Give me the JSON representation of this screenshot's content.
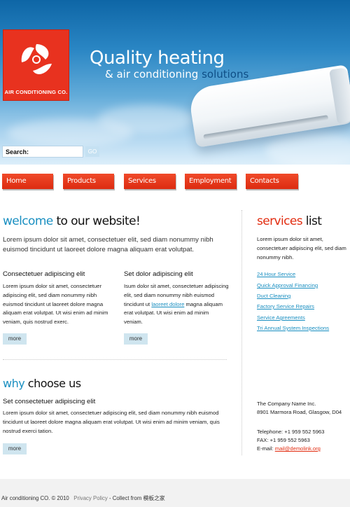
{
  "header": {
    "logo_text": "AIR CONDITIONING CO.",
    "tagline_main": "Quality heating",
    "tagline_sub_a": "& air conditioning ",
    "tagline_sub_b": "solutions"
  },
  "search": {
    "label": "Search:",
    "value": "",
    "button_label": "GO"
  },
  "nav": {
    "items": [
      {
        "label": "Home"
      },
      {
        "label": "Products"
      },
      {
        "label": "Services"
      },
      {
        "label": "Employment"
      },
      {
        "label": "Contacts"
      }
    ]
  },
  "welcome": {
    "title_a": "welcome",
    "title_b": " to our website!",
    "lead": "Lorem ipsum dolor sit amet, consectetuer elit, sed diam nonummy nibh euismod tincidunt ut laoreet dolore magna aliquam erat volutpat.",
    "col1": {
      "heading": "Consectetuer adipiscing elit",
      "text": "Lorem ipsum dolor sit amet, consectetuer adipiscing elit, sed diam nonummy nibh euismod tincidunt ut laoreet dolore magna aliquam erat volutpat. Ut wisi enim ad minim veniam, quis nostrud exerc.",
      "more_label": "more"
    },
    "col2": {
      "heading": "Set dolor adipiscing elit",
      "text_a": "Isum dolor sit amet, consectetuer adipiscing elit, sed diam nonummy nibh euismod tincidunt ut ",
      "link": "laoreet dolore",
      "text_b": " magna aliquam erat volutpat. Ut wisi enim ad minim veniam.",
      "more_label": "more"
    }
  },
  "why": {
    "title_a": "why",
    "title_b": " choose us",
    "heading": "Set consectetuer adipiscing elit",
    "text": "Lorem ipsum dolor sit amet, consectetuer adipiscing elit, sed diam nonummy nibh euismod tincidunt ut laoreet dolore magna aliquam erat volutpat. Ut wisi enim ad minim veniam, quis nostrud exerci tation.",
    "more_label": "more"
  },
  "services": {
    "title_a": "services",
    "title_b": " list",
    "text": "Lorem ipsum dolor sit amet, consectetuer adipiscing elit, sed diam nonummy nibh.",
    "links": [
      "24 Hour Service",
      "Quick Approval Financing",
      "Duct Cleaning",
      "Factory Service Repairs",
      "Service Agreements",
      "Tri Annual System Inspections"
    ]
  },
  "contact": {
    "company": "The Company Name Inc.",
    "address": "8901 Marmora Road, Glasgow, D04",
    "telephone": "Telephone: +1 959 552 5963",
    "fax": "FAX: +1 959 552 5963",
    "email_label": "E-mail: ",
    "email": "mail@demolink.org"
  },
  "footer": {
    "copyright": "Air conditioning CO. © 2010",
    "privacy": "Privacy Policy",
    "collect": " - Collect from ",
    "site": "模板之家"
  },
  "colors": {
    "accent_red": "#e22c10",
    "accent_blue": "#1a8fc1",
    "sky": "#2a86c4"
  }
}
